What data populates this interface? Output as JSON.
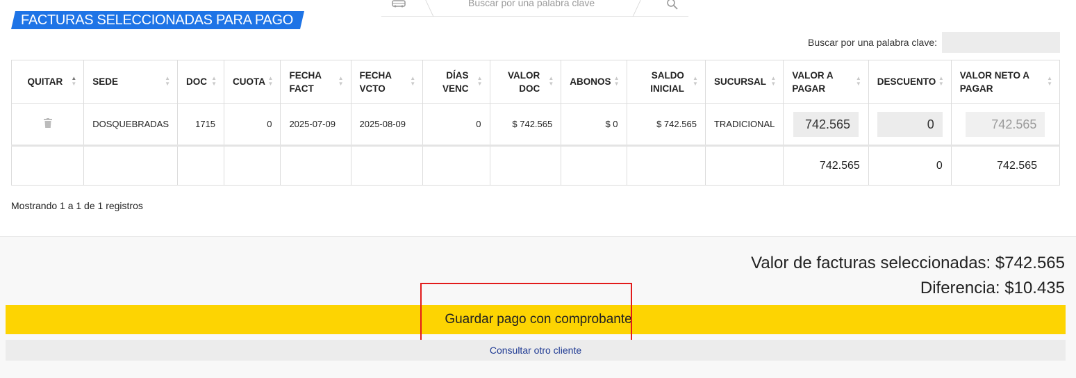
{
  "top_search": {
    "placeholder": "Buscar por una palabra clave"
  },
  "title": "FACTURAS SELECCIONADAS PARA PAGO",
  "search": {
    "label": "Buscar por una palabra clave:",
    "value": ""
  },
  "table": {
    "headers": {
      "quitar": "QUITAR",
      "sede": "SEDE",
      "doc": "DOC",
      "cuota": "CUOTA",
      "fecha_fact_1": "FECHA",
      "fecha_fact_2": "FACT",
      "fecha_vcto_1": "FECHA",
      "fecha_vcto_2": "VCTO",
      "dias_venc_1": "DÍAS",
      "dias_venc_2": "VENC",
      "valor_doc_1": "VALOR",
      "valor_doc_2": "DOC",
      "abonos": "ABONOS",
      "saldo_inicial_1": "SALDO",
      "saldo_inicial_2": "INICIAL",
      "sucursal": "SUCURSAL",
      "valor_pagar_1": "VALOR A",
      "valor_pagar_2": "PAGAR",
      "descuento": "DESCUENTO",
      "valor_neto_1": "VALOR NETO A",
      "valor_neto_2": "PAGAR"
    },
    "row": {
      "sede": "DOSQUEBRADAS",
      "doc": "1715",
      "cuota": "0",
      "fecha_fact": "2025-07-09",
      "fecha_vcto": "2025-08-09",
      "dias_venc": "0",
      "valor_doc": "$ 742.565",
      "abonos": "$ 0",
      "saldo_inicial": "$ 742.565",
      "sucursal": "TRADICIONAL",
      "valor_pagar": "742.565",
      "descuento": "0",
      "valor_neto": "742.565"
    },
    "totals": {
      "valor_pagar": "742.565",
      "descuento": "0",
      "valor_neto": "742.565"
    }
  },
  "showing": "Mostrando 1 a 1 de 1 registros",
  "summary": {
    "selected": "Valor de facturas seleccionadas: $742.565",
    "difference": "Diferencia: $10.435"
  },
  "buttons": {
    "save_payment": "Guardar pago con comprobante",
    "other_client": "Consultar otro cliente"
  },
  "colors": {
    "accent": "#1e74e6",
    "button": "#fdd402",
    "highlight": "#e21b1b"
  }
}
